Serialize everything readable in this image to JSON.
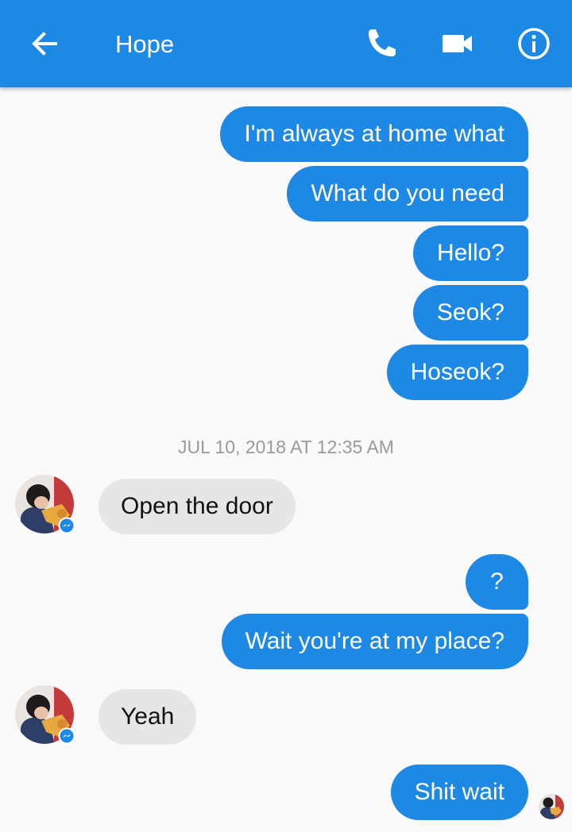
{
  "header": {
    "title": "Hope",
    "icons": [
      "back-arrow-icon",
      "phone-icon",
      "video-camera-icon",
      "info-icon"
    ]
  },
  "colors": {
    "appbar": "#1e88e5",
    "outgoing_bubble": "#1e88e5",
    "incoming_bubble": "#e6e6e6",
    "background": "#f9f9f9",
    "messenger_badge": "#1e88e5"
  },
  "conversation": {
    "messages_before": [
      "I'm always at home what",
      "What do you need",
      "Hello?",
      "Seok?",
      "Hoseok?"
    ],
    "timestamp": "JUL 10, 2018 AT 12:35 AM",
    "incoming_1": "Open the door",
    "outgoing_2": [
      "?",
      "Wait you're at my place?"
    ],
    "incoming_2": "Yeah",
    "outgoing_3": "Shit wait"
  }
}
